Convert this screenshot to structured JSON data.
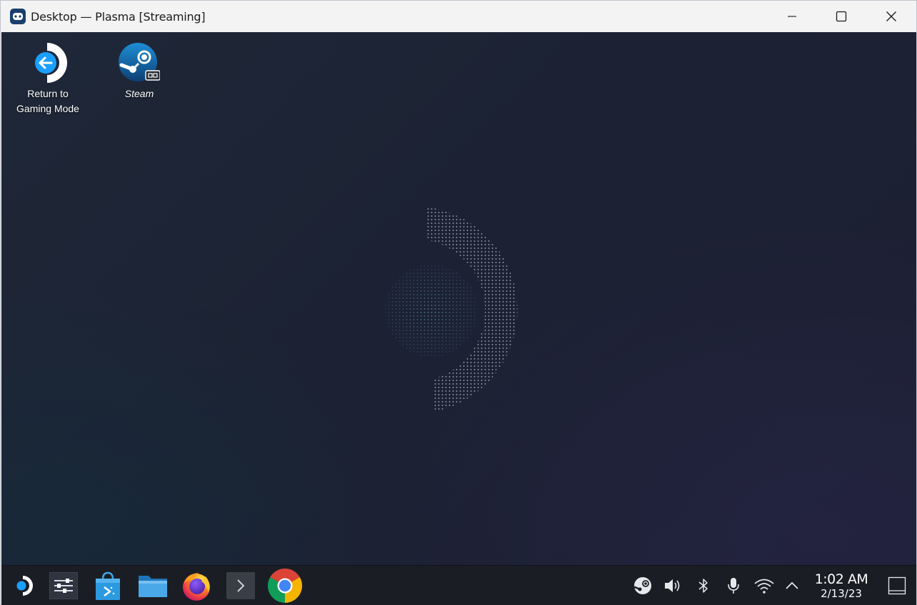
{
  "window": {
    "title": "Desktop — Plasma [Streaming]",
    "app_icon": "gamepad-icon",
    "controls": {
      "minimize": "minimize-icon",
      "maximize": "maximize-icon",
      "close": "close-icon"
    }
  },
  "desktop": {
    "icons": [
      {
        "label": "Return to\nGaming Mode",
        "icon": "return-to-gaming-mode-icon"
      },
      {
        "label": "Steam",
        "icon": "steam-icon"
      }
    ],
    "wallpaper": "steam-deck-logo"
  },
  "taskbar": {
    "launchers": [
      {
        "name": "application-launcher",
        "icon": "steamdeck-logo-icon"
      },
      {
        "name": "system-settings",
        "icon": "settings-sliders-icon"
      },
      {
        "name": "discover-store",
        "icon": "store-bag-icon"
      },
      {
        "name": "dolphin-file-manager",
        "icon": "folder-icon"
      },
      {
        "name": "firefox",
        "icon": "firefox-icon"
      },
      {
        "name": "konsole",
        "icon": "terminal-icon"
      },
      {
        "name": "chrome",
        "icon": "chrome-icon"
      }
    ],
    "tray": [
      {
        "name": "steam-tray",
        "icon": "steam-tray-icon"
      },
      {
        "name": "volume",
        "icon": "speaker-icon"
      },
      {
        "name": "bluetooth",
        "icon": "bluetooth-icon"
      },
      {
        "name": "microphone",
        "icon": "microphone-icon"
      },
      {
        "name": "wifi",
        "icon": "wifi-icon"
      },
      {
        "name": "show-hidden",
        "icon": "chevron-up-icon"
      }
    ],
    "clock": {
      "time": "1:02 AM",
      "date": "2/13/23"
    },
    "show_desktop": "show-desktop-icon"
  }
}
